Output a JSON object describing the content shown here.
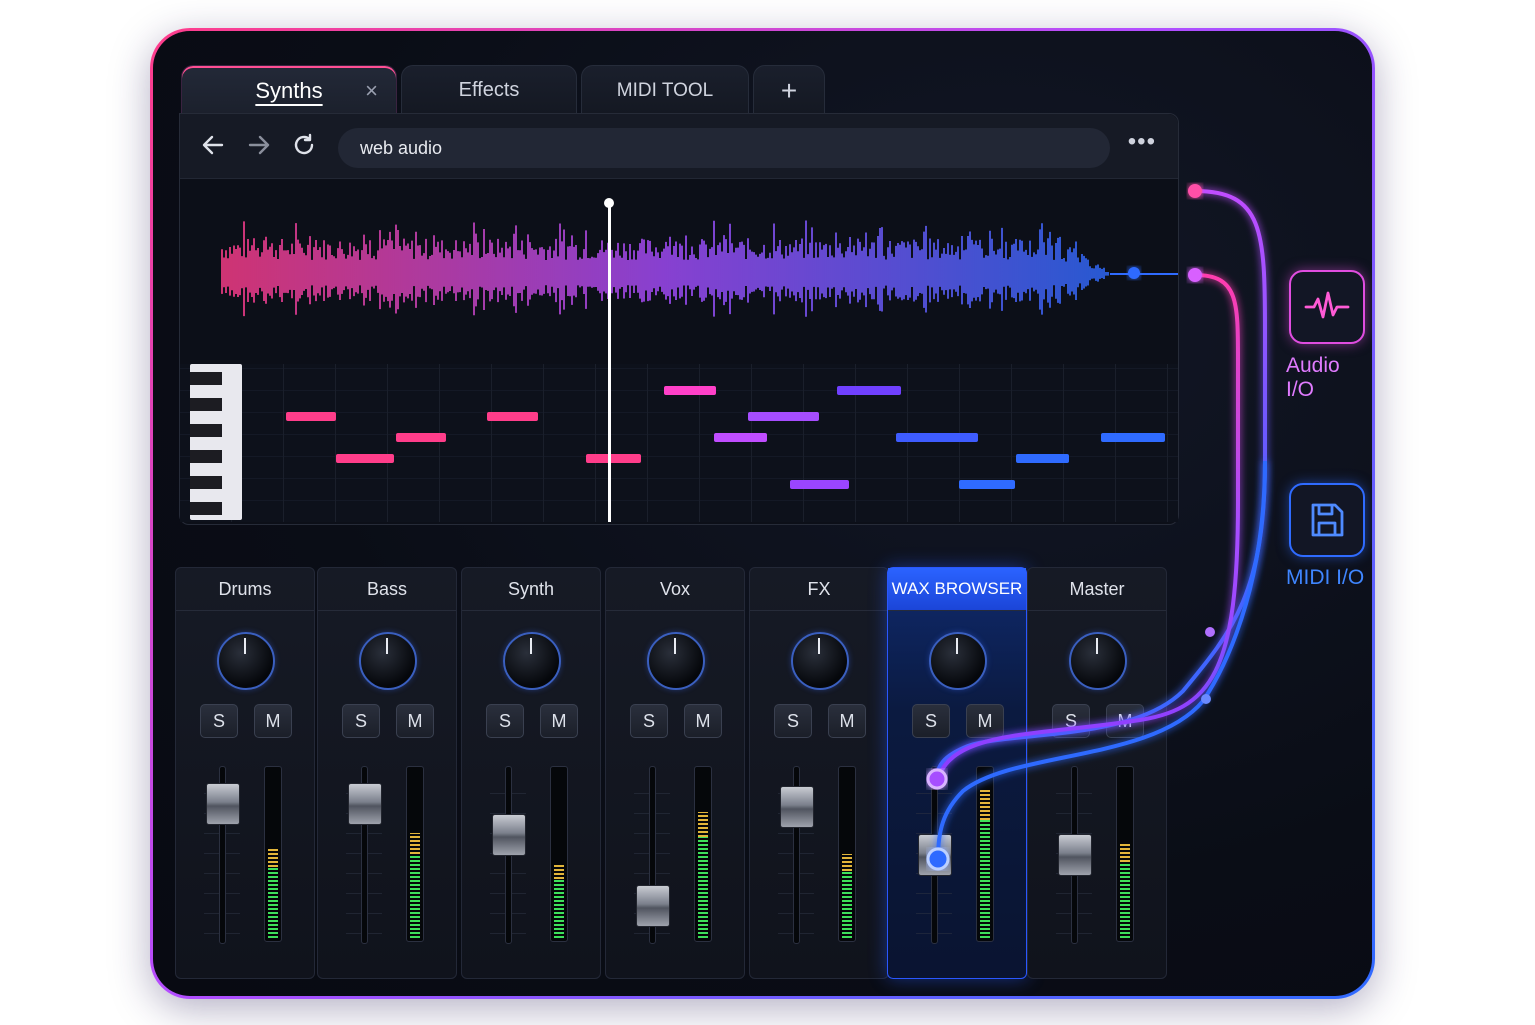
{
  "tabs": [
    {
      "label": "Synths",
      "active": true,
      "close": "×"
    },
    {
      "label": "Effects"
    },
    {
      "label": "MIDI TOOL"
    },
    {
      "label": "+"
    }
  ],
  "toolbar": {
    "back_icon": "arrow-left-icon",
    "forward_icon": "arrow-right-icon",
    "reload_icon": "reload-icon",
    "url": "web audio",
    "more": "•••"
  },
  "channels": [
    {
      "name": "Drums",
      "solo": "S",
      "mute": "M",
      "fader_level": 0.9,
      "meter_level": 0.42
    },
    {
      "name": "Bass",
      "solo": "S",
      "mute": "M",
      "fader_level": 0.9,
      "meter_level": 0.5
    },
    {
      "name": "Synth",
      "solo": "S",
      "mute": "M",
      "fader_level": 0.72,
      "meter_level": 0.35
    },
    {
      "name": "Vox",
      "solo": "S",
      "mute": "M",
      "fader_level": 0.3,
      "meter_level": 0.6
    },
    {
      "name": "FX",
      "solo": "S",
      "mute": "M",
      "fader_level": 0.88,
      "meter_level": 0.4
    },
    {
      "name": "WAX BROWSER",
      "solo": "S",
      "mute": "M",
      "fader_level": 0.6,
      "meter_level": 0.7,
      "selected": true
    },
    {
      "name": "Master",
      "solo": "S",
      "mute": "M",
      "fader_level": 0.6,
      "meter_level": 0.45
    }
  ],
  "io": {
    "audio": {
      "label": "Audio I/O",
      "icon": "waveform-icon"
    },
    "midi": {
      "label": "MIDI I/O",
      "icon": "floppy-disk-icon"
    }
  },
  "colors": {
    "pink": "#ff3d8a",
    "purple": "#a64dff",
    "blue": "#2f6bff",
    "accent_selected": "#2b63ff"
  }
}
